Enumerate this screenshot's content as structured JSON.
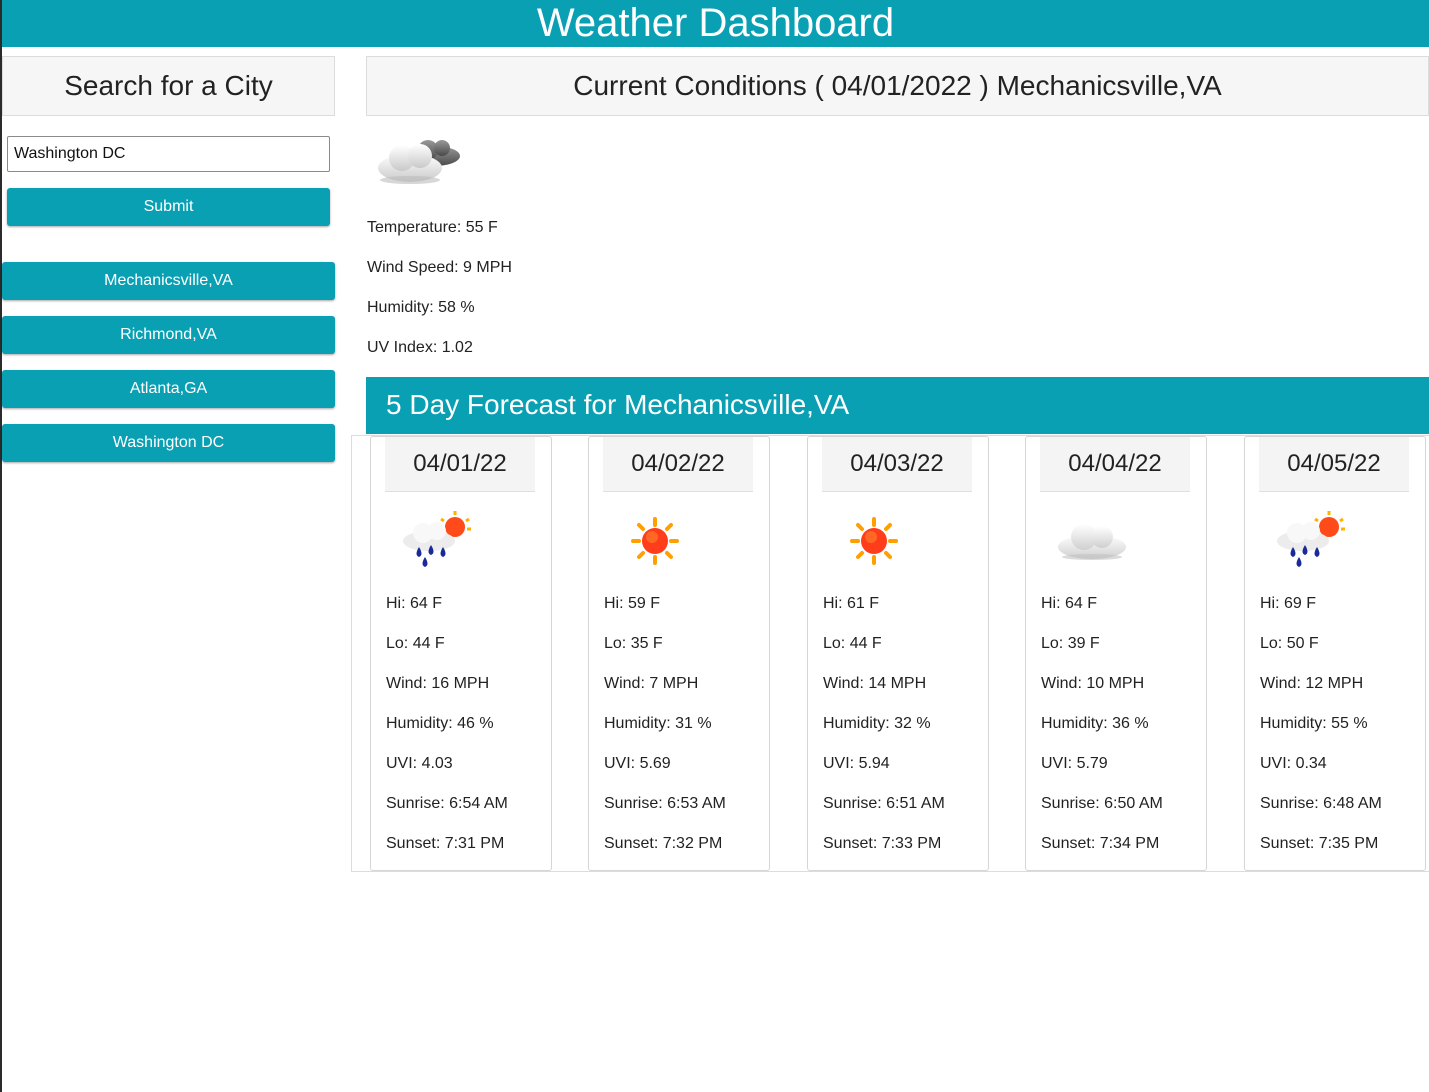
{
  "header": {
    "title": "Weather Dashboard"
  },
  "search": {
    "title": "Search for a City",
    "input_value": "Washington DC",
    "submit_label": "Submit",
    "history": [
      "Mechanicsville,VA",
      "Richmond,VA",
      "Atlanta,GA",
      "Washington DC"
    ]
  },
  "current": {
    "title": "Current Conditions ( 04/01/2022 ) Mechanicsville,VA",
    "icon": "partly-cloudy-icon",
    "temperature": "Temperature: 55 F",
    "wind": "Wind Speed: 9 MPH",
    "humidity": "Humidity: 58 %",
    "uv": "UV Index: 1.02"
  },
  "forecast": {
    "title": "5 Day Forecast for Mechanicsville,VA",
    "days": [
      {
        "date": "04/01/22",
        "icon": "rain-sun-icon",
        "hi": "Hi: 64 F",
        "lo": "Lo: 44 F",
        "wind": "Wind: 16 MPH",
        "humidity": "Humidity: 46 %",
        "uvi": "UVI: 4.03",
        "sunrise": "Sunrise: 6:54 AM",
        "sunset": "Sunset: 7:31 PM"
      },
      {
        "date": "04/02/22",
        "icon": "sun-icon",
        "hi": "Hi: 59 F",
        "lo": "Lo: 35 F",
        "wind": "Wind: 7 MPH",
        "humidity": "Humidity: 31 %",
        "uvi": "UVI: 5.69",
        "sunrise": "Sunrise: 6:53 AM",
        "sunset": "Sunset: 7:32 PM"
      },
      {
        "date": "04/03/22",
        "icon": "sun-icon",
        "hi": "Hi: 61 F",
        "lo": "Lo: 44 F",
        "wind": "Wind: 14 MPH",
        "humidity": "Humidity: 32 %",
        "uvi": "UVI: 5.94",
        "sunrise": "Sunrise: 6:51 AM",
        "sunset": "Sunset: 7:33 PM"
      },
      {
        "date": "04/04/22",
        "icon": "cloud-icon",
        "hi": "Hi: 64 F",
        "lo": "Lo: 39 F",
        "wind": "Wind: 10 MPH",
        "humidity": "Humidity: 36 %",
        "uvi": "UVI: 5.79",
        "sunrise": "Sunrise: 6:50 AM",
        "sunset": "Sunset: 7:34 PM"
      },
      {
        "date": "04/05/22",
        "icon": "rain-sun-icon",
        "hi": "Hi: 69 F",
        "lo": "Lo: 50 F",
        "wind": "Wind: 12 MPH",
        "humidity": "Humidity: 55 %",
        "uvi": "UVI: 0.34",
        "sunrise": "Sunrise: 6:48 AM",
        "sunset": "Sunset: 7:35 PM"
      }
    ]
  },
  "colors": {
    "accent": "#0aa0b4",
    "card_header_bg": "#f6f6f6",
    "border": "#dcdcdc"
  }
}
